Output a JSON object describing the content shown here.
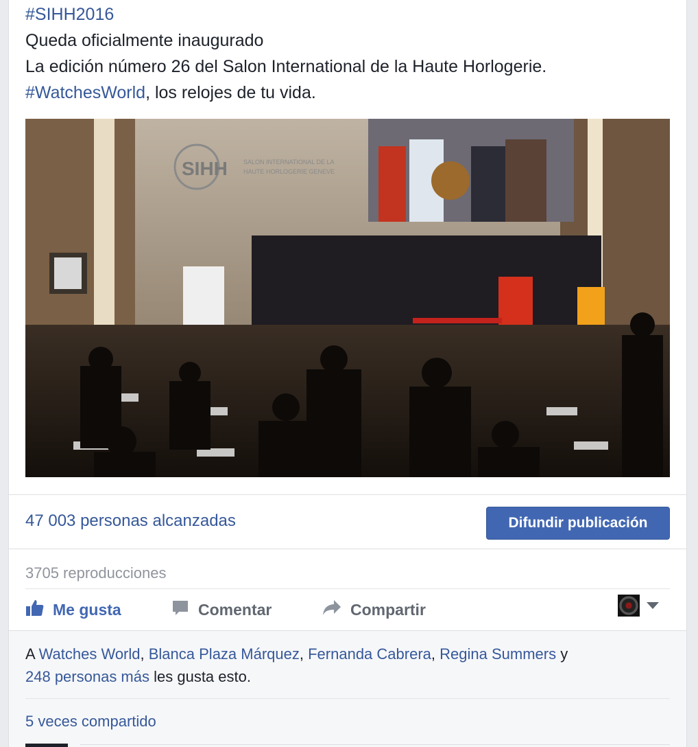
{
  "post": {
    "hashtag": "#SIHH2016",
    "line1": "Queda oficialmente inaugurado",
    "line2": "La edición número 26 del Salon International de la Haute Horlogerie.",
    "hashtag2": "#WatchesWorld",
    "line3_rest": ", los relojes de tu vida."
  },
  "video": {
    "logo_text": "SIHH",
    "logo_sub1": "SALON INTERNATIONAL DE LA",
    "logo_sub2": "HAUTE HORLOGERIE GENEVE"
  },
  "stats": {
    "reach": "47 003 personas alcanzadas",
    "boost_label": "Difundir publicación",
    "views": "3705 reproducciones"
  },
  "actions": {
    "like": "Me gusta",
    "comment": "Comentar",
    "share": "Compartir"
  },
  "likes": {
    "prefix": "A ",
    "names": [
      "Watches World",
      "Blanca Plaza Márquez",
      "Fernanda Cabrera",
      "Regina Summers"
    ],
    "sep": ", ",
    "y": " y",
    "more": "248 personas más",
    "suffix": " les gusta esto."
  },
  "shares": "5 veces compartido",
  "colors": {
    "link": "#365899",
    "button": "#4267b2",
    "like_active": "#4267b2"
  }
}
